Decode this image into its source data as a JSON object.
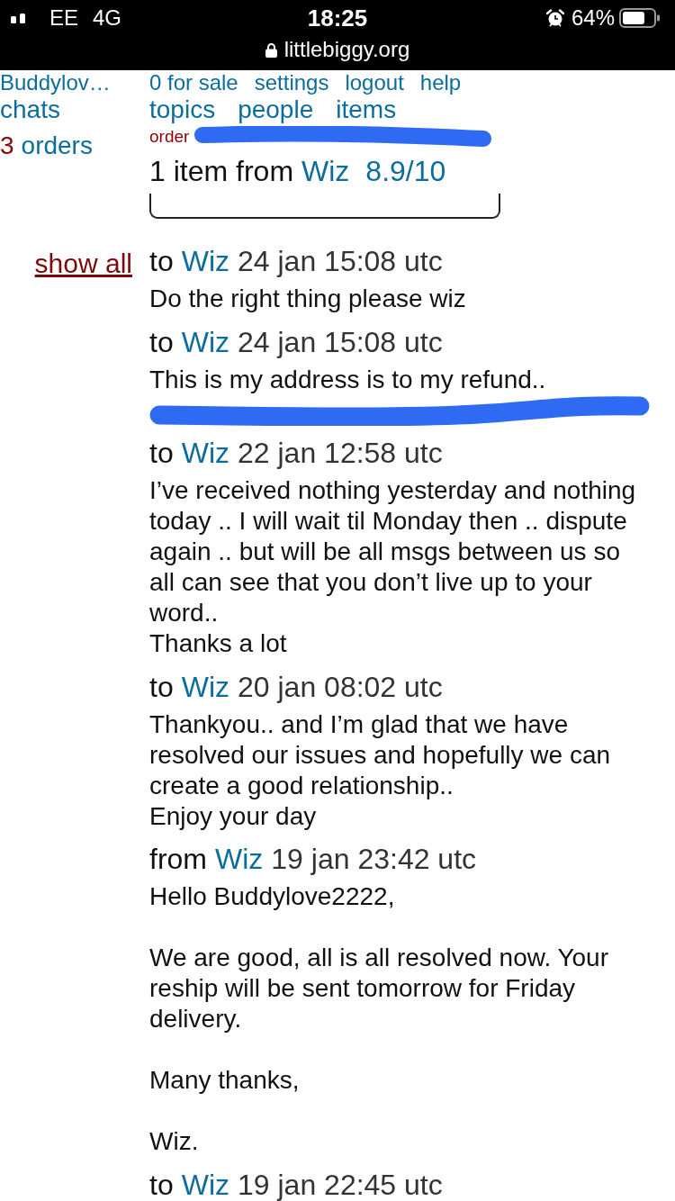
{
  "status_bar": {
    "carrier": "EE",
    "network": "4G",
    "time": "18:25",
    "battery": "64%",
    "url": "littlebiggy.org"
  },
  "sidebar": {
    "user": "Buddylov…",
    "chats": "chats",
    "orders_count": "3",
    "orders": "orders",
    "show_all": "show all"
  },
  "top_links": [
    "0 for sale",
    "settings",
    "logout",
    "help"
  ],
  "main_links": [
    "topics",
    "people",
    "items"
  ],
  "order": {
    "label": "order",
    "id_redacted": true
  },
  "summary": {
    "text": "1 item from",
    "seller": "Wiz",
    "rating": "8.9/10"
  },
  "messages": [
    {
      "direction": "to",
      "contact": "Wiz",
      "time": "24 jan 15:08 utc",
      "body": [
        [
          "Do the right thing please wiz"
        ]
      ]
    },
    {
      "direction": "to",
      "contact": "Wiz",
      "time": "24 jan 15:08 utc",
      "body": [
        [
          "This is my address is to my refund.."
        ]
      ],
      "redacted": true
    },
    {
      "direction": "to",
      "contact": "Wiz",
      "time": "22 jan 12:58 utc",
      "body": [
        [
          "I’ve received nothing yesterday and nothing today .. I will wait til Monday then .. dispute again .. but will be all msgs between us so all can see that you don’t live up to your word..",
          "Thanks a lot"
        ]
      ]
    },
    {
      "direction": "to",
      "contact": "Wiz",
      "time": "20 jan 08:02 utc",
      "body": [
        [
          "Thankyou.. and I’m glad that we have resolved our issues and hopefully we can create a good relationship..",
          "Enjoy your day"
        ]
      ]
    },
    {
      "direction": "from",
      "contact": "Wiz",
      "time": "19 jan 23:42 utc",
      "body": [
        [
          "Hello Buddylove2222,"
        ],
        [
          "We are good, all is all resolved now. Your reship will be sent tomorrow for Friday delivery."
        ],
        [
          "Many thanks,"
        ],
        [
          "Wiz."
        ]
      ]
    },
    {
      "direction": "to",
      "contact": "Wiz",
      "time": "19 jan 22:45 utc"
    }
  ]
}
